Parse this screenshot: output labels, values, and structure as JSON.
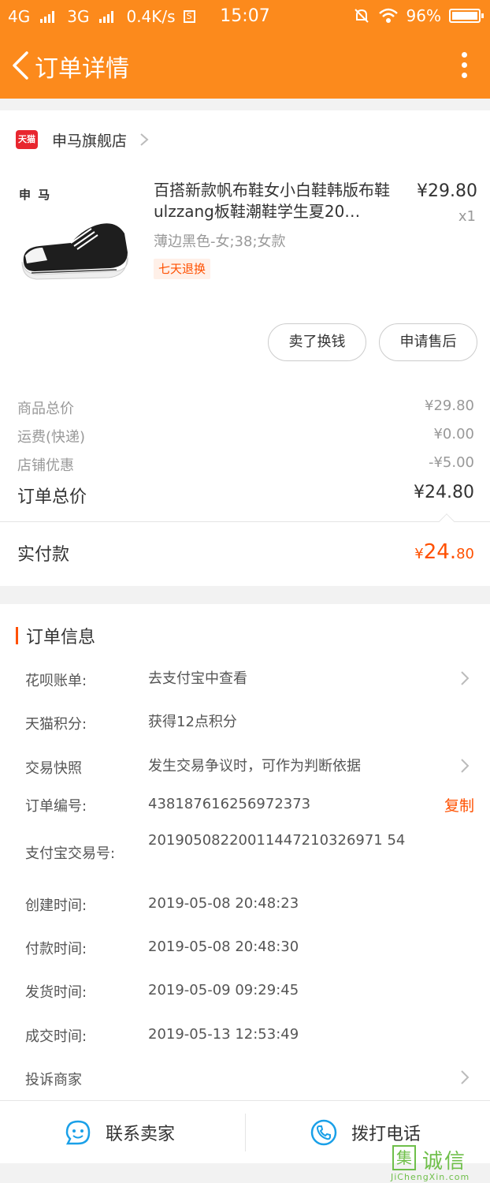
{
  "status_bar": {
    "net1": "4G",
    "net2": "3G",
    "speed": "0.4K/s",
    "sim_icon": "S",
    "time": "15:07",
    "battery": "96%"
  },
  "header": {
    "title": "订单详情",
    "back_icon": "chevron-left-icon",
    "more_icon": "more-vertical-icon",
    "color": "#fc8a1c"
  },
  "store": {
    "badge": "天猫",
    "name": "申马旗舰店",
    "brand_color": "#e8262f"
  },
  "product": {
    "brand_mark": "申 马",
    "title": "百搭新款帆布鞋女小白鞋韩版布鞋ulzzang板鞋潮鞋学生夏20…",
    "price": "¥29.80",
    "qty": "x1",
    "spec": "薄边黑色-女;38;女款",
    "tag": "七天退换"
  },
  "actions": {
    "sell": "卖了换钱",
    "after_sale": "申请售后"
  },
  "price_summary": {
    "goods_label": "商品总价",
    "goods_value": "¥29.80",
    "shipping_label": "运费(快递)",
    "shipping_value": "¥0.00",
    "discount_label": "店铺优惠",
    "discount_value": "-¥5.00",
    "total_label": "订单总价",
    "total_value": "¥24.80",
    "paid_label": "实付款",
    "paid_currency": "¥",
    "paid_int": "24.",
    "paid_dec": "80",
    "accent_color": "#ff5000"
  },
  "order_info": {
    "title": "订单信息",
    "huabei_label": "花呗账单:",
    "huabei_value": "去支付宝中查看",
    "points_label": "天猫积分:",
    "points_value": "获得12点积分",
    "snapshot_label": "交易快照",
    "snapshot_value": "发生交易争议时，可作为判断依据",
    "order_no_label": "订单编号:",
    "order_no_value": "438187616256972373",
    "copy_label": "复制",
    "alipay_label": "支付宝交易号:",
    "alipay_value": "20190508220011447210326971 54",
    "created_label": "创建时间:",
    "created_value": "2019-05-08 20:48:23",
    "paid_label": "付款时间:",
    "paid_value": "2019-05-08 20:48:30",
    "shipped_label": "发货时间:",
    "shipped_value": "2019-05-09 09:29:45",
    "done_label": "成交时间:",
    "done_value": "2019-05-13 12:53:49",
    "complaint_label": "投诉商家"
  },
  "bottom": {
    "contact": "联系卖家",
    "call": "拨打电话"
  },
  "watermark": {
    "box": "集",
    "text": "诚信",
    "url": "JiChengXin.com"
  }
}
